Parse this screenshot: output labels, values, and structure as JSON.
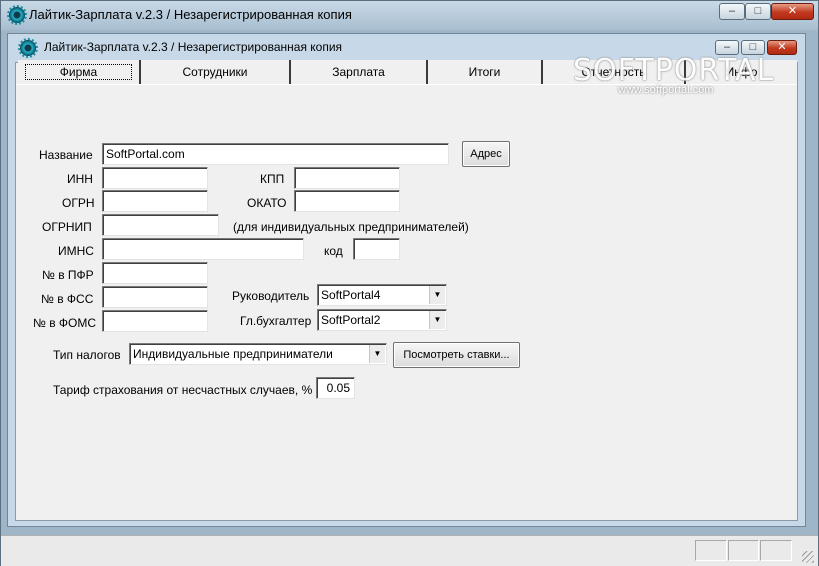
{
  "window": {
    "title": "Лайтик-Зарплата v.2.3 / Незарегистрированная копия"
  },
  "mdi": {
    "title": "Лайтик-Зарплата v.2.3 / Незарегистрированная копия"
  },
  "tabs": [
    {
      "label": "Фирма"
    },
    {
      "label": "Сотрудники"
    },
    {
      "label": "Зарплата"
    },
    {
      "label": "Итоги"
    },
    {
      "label": "Отчетность"
    },
    {
      "label": "Инфо"
    }
  ],
  "watermark": {
    "brand": "SOFTPORTAL",
    "url": "www.softportal.com"
  },
  "form": {
    "name_label": "Название",
    "name_value": "SoftPortal.com",
    "address_button": "Адрес",
    "inn_label": "ИНН",
    "inn_value": "",
    "kpp_label": "КПП",
    "kpp_value": "",
    "ogrn_label": "ОГРН",
    "ogrn_value": "",
    "okato_label": "ОКАТО",
    "okato_value": "",
    "ogrnip_label": "ОГРНИП",
    "ogrnip_value": "",
    "ogrnip_hint": "(для индивидуальных предпринимателей)",
    "imns_label": "ИМНС",
    "imns_value": "",
    "kod_label": "код",
    "kod_value": "",
    "pfr_label": "№ в ПФР",
    "pfr_value": "",
    "fss_label": "№ в ФСС",
    "fss_value": "",
    "foms_label": "№ в ФОМС",
    "foms_value": "",
    "director_label": "Руководитель",
    "director_value": "SoftPortal4",
    "accountant_label": "Гл.бухгалтер",
    "accountant_value": "SoftPortal2",
    "tax_label": "Тип налогов",
    "tax_value": "Индивидуальные предприниматели",
    "rates_button": "Посмотреть ставки...",
    "insurance_label": "Тариф страхования от несчастных случаев, %",
    "insurance_value": "0.05"
  },
  "window_buttons": {
    "minimize": "–",
    "maximize": "□",
    "close": "✕"
  }
}
